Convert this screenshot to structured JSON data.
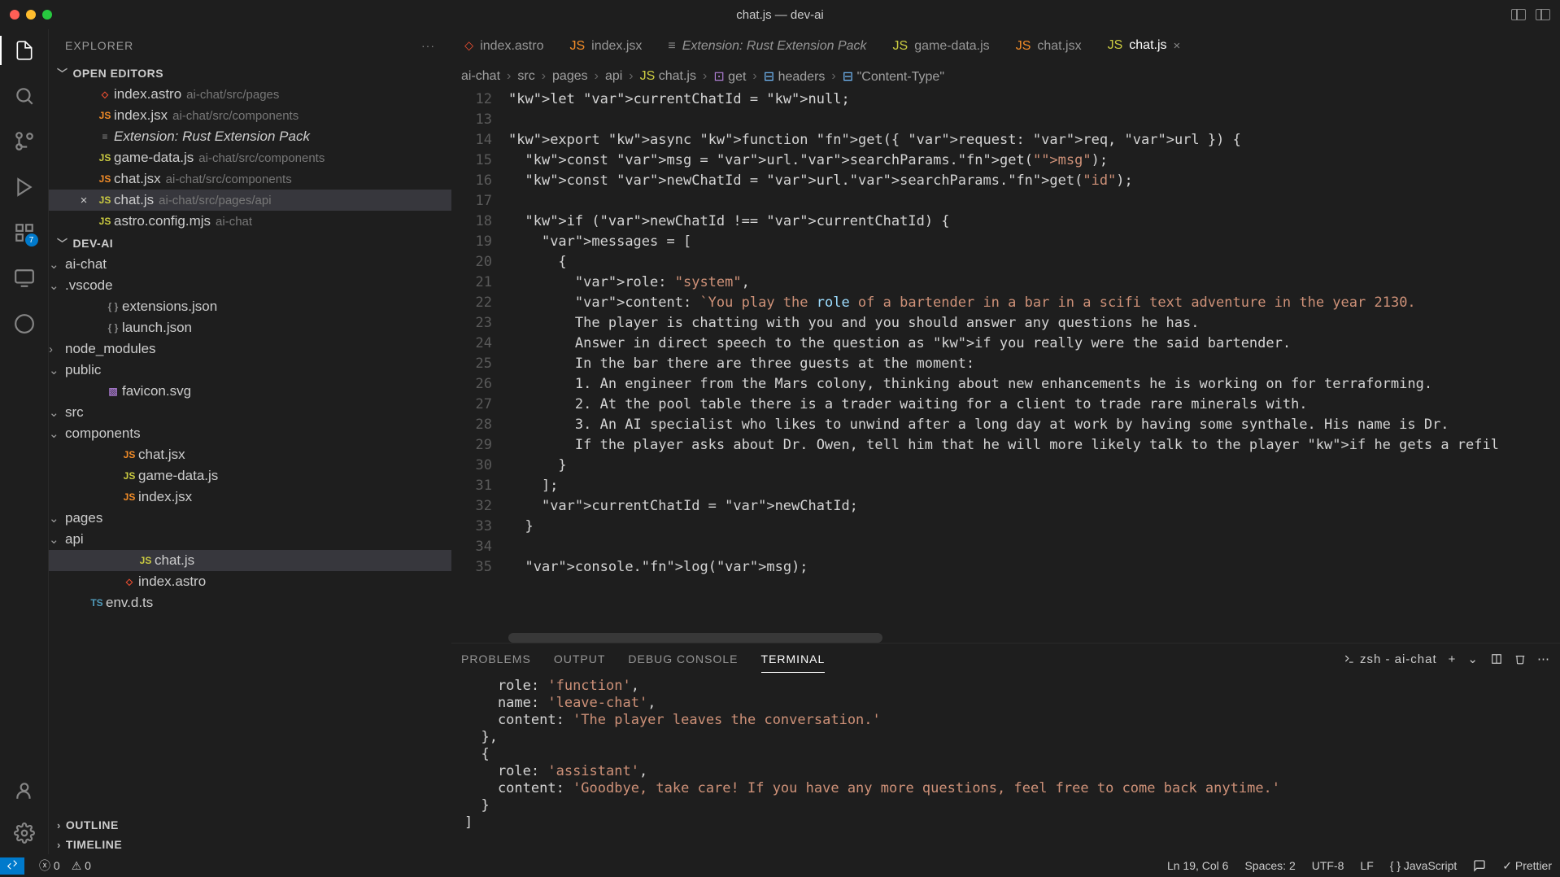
{
  "window": {
    "title": "chat.js — dev-ai"
  },
  "tabs": [
    {
      "icon": "astro",
      "label": "index.astro",
      "active": false,
      "italic": false
    },
    {
      "icon": "jsx",
      "label": "index.jsx",
      "active": false,
      "italic": false
    },
    {
      "icon": "ext",
      "label": "Extension: Rust Extension Pack",
      "active": false,
      "italic": true
    },
    {
      "icon": "js",
      "label": "game-data.js",
      "active": false,
      "italic": false
    },
    {
      "icon": "jsx",
      "label": "chat.jsx",
      "active": false,
      "italic": false
    },
    {
      "icon": "js",
      "label": "chat.js",
      "active": true,
      "italic": false
    }
  ],
  "sidebar": {
    "title": "EXPLORER",
    "sections": {
      "openEditors": {
        "label": "OPEN EDITORS",
        "items": [
          {
            "icon": "astro",
            "name": "index.astro",
            "desc": "ai-chat/src/pages"
          },
          {
            "icon": "jsx",
            "name": "index.jsx",
            "desc": "ai-chat/src/components"
          },
          {
            "icon": "ext",
            "name": "Extension: Rust Extension Pack",
            "desc": "",
            "italic": true
          },
          {
            "icon": "js",
            "name": "game-data.js",
            "desc": "ai-chat/src/components"
          },
          {
            "icon": "jsx",
            "name": "chat.jsx",
            "desc": "ai-chat/src/components"
          },
          {
            "icon": "js",
            "name": "chat.js",
            "desc": "ai-chat/src/pages/api",
            "active": true
          },
          {
            "icon": "js",
            "name": "astro.config.mjs",
            "desc": "ai-chat"
          }
        ]
      },
      "project": {
        "label": "DEV-AI"
      },
      "outline": {
        "label": "OUTLINE"
      },
      "timeline": {
        "label": "TIMELINE"
      }
    },
    "tree": {
      "root": "ai-chat",
      "children": [
        {
          "name": ".vscode",
          "type": "folder",
          "open": true,
          "children": [
            {
              "name": "extensions.json",
              "icon": "json"
            },
            {
              "name": "launch.json",
              "icon": "json"
            }
          ]
        },
        {
          "name": "node_modules",
          "type": "folder",
          "open": false
        },
        {
          "name": "public",
          "type": "folder",
          "open": true,
          "children": [
            {
              "name": "favicon.svg",
              "icon": "svg"
            }
          ]
        },
        {
          "name": "src",
          "type": "folder",
          "open": true,
          "children": [
            {
              "name": "components",
              "type": "folder",
              "open": true,
              "children": [
                {
                  "name": "chat.jsx",
                  "icon": "jsx"
                },
                {
                  "name": "game-data.js",
                  "icon": "js"
                },
                {
                  "name": "index.jsx",
                  "icon": "jsx"
                }
              ]
            },
            {
              "name": "pages",
              "type": "folder",
              "open": true,
              "children": [
                {
                  "name": "api",
                  "type": "folder",
                  "open": true,
                  "children": [
                    {
                      "name": "chat.js",
                      "icon": "js",
                      "active": true
                    }
                  ]
                },
                {
                  "name": "index.astro",
                  "icon": "astro"
                }
              ]
            }
          ]
        },
        {
          "name": "env.d.ts",
          "icon": "ts"
        }
      ]
    }
  },
  "breadcrumbs": [
    {
      "text": "ai-chat"
    },
    {
      "text": "src"
    },
    {
      "text": "pages"
    },
    {
      "text": "api"
    },
    {
      "text": "chat.js",
      "icon": "js"
    },
    {
      "text": "get",
      "icon": "method"
    },
    {
      "text": "headers",
      "icon": "field"
    },
    {
      "text": "\"Content-Type\"",
      "icon": "field"
    }
  ],
  "editor": {
    "startLine": 12,
    "lines": [
      "let currentChatId = null;",
      "",
      "export async function get({ request: req, url }) {",
      "  const msg = url.searchParams.get(\"msg\");",
      "  const newChatId = url.searchParams.get(\"id\");",
      "",
      "  if (newChatId !== currentChatId) {",
      "    messages = [",
      "      {",
      "        role: \"system\",",
      "        content: `You play the role of a bartender in a bar in a scifi text adventure in the year 2130.",
      "        The player is chatting with you and you should answer any questions he has.",
      "        Answer in direct speech to the question as if you really were the said bartender.",
      "        In the bar there are three guests at the moment:",
      "        1. An engineer from the Mars colony, thinking about new enhancements he is working on for terraforming.",
      "        2. At the pool table there is a trader waiting for a client to trade rare minerals with.",
      "        3. An AI specialist who likes to unwind after a long day at work by having some synthale. His name is Dr.",
      "        If the player asks about Dr. Owen, tell him that he will more likely talk to the player if he gets a refil",
      "      }",
      "    ];",
      "    currentChatId = newChatId;",
      "  }",
      "",
      "  console.log(msg);"
    ]
  },
  "panel": {
    "tabs": [
      "PROBLEMS",
      "OUTPUT",
      "DEBUG CONSOLE",
      "TERMINAL"
    ],
    "activeTab": "TERMINAL",
    "terminalLabel": "zsh - ai-chat",
    "content": [
      "    role: 'function',",
      "    name: 'leave-chat',",
      "    content: 'The player leaves the conversation.'",
      "  },",
      "  {",
      "    role: 'assistant',",
      "    content: 'Goodbye, take care! If you have any more questions, feel free to come back anytime.'",
      "  }",
      "]"
    ]
  },
  "statusbar": {
    "errors": "0",
    "warnings": "0",
    "position": "Ln 19, Col 6",
    "spaces": "Spaces: 2",
    "encoding": "UTF-8",
    "eol": "LF",
    "language": "JavaScript",
    "prettier": "Prettier"
  },
  "badge": "7"
}
